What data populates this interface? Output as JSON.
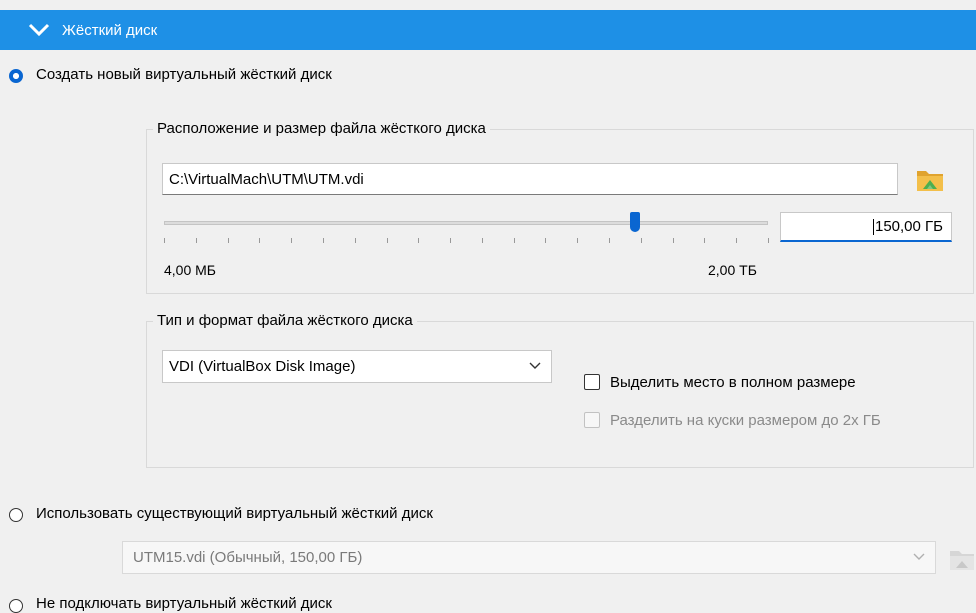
{
  "header": {
    "title": "Жёсткий диск"
  },
  "options": {
    "create_new": "Создать новый виртуальный жёсткий диск",
    "use_existing": "Использовать существующий виртуальный жёсткий диск",
    "no_disk": "Не подключать виртуальный жёсткий диск"
  },
  "location_group": {
    "title": "Расположение и размер файла жёсткого диска",
    "path": "C:\\VirtualMach\\UTM\\UTM.vdi",
    "size_value": "150,00 ГБ",
    "size_level_fraction": 0.78,
    "min_label": "4,00 МБ",
    "max_label": "2,00 ТБ"
  },
  "type_group": {
    "title": "Тип и формат файла жёсткого диска",
    "format_selected": "VDI (VirtualBox Disk Image)",
    "preallocate_label": "Выделить место в полном размере",
    "split_label": "Разделить на куски размером до 2х ГБ"
  },
  "existing_disk": {
    "selected": "UTM15.vdi (Обычный, 150,00 ГБ)"
  },
  "colors": {
    "accent": "#1e90e6",
    "radio_checked": "#0a66d1"
  },
  "icons": [
    "chevron-down-icon",
    "folder-icon"
  ]
}
